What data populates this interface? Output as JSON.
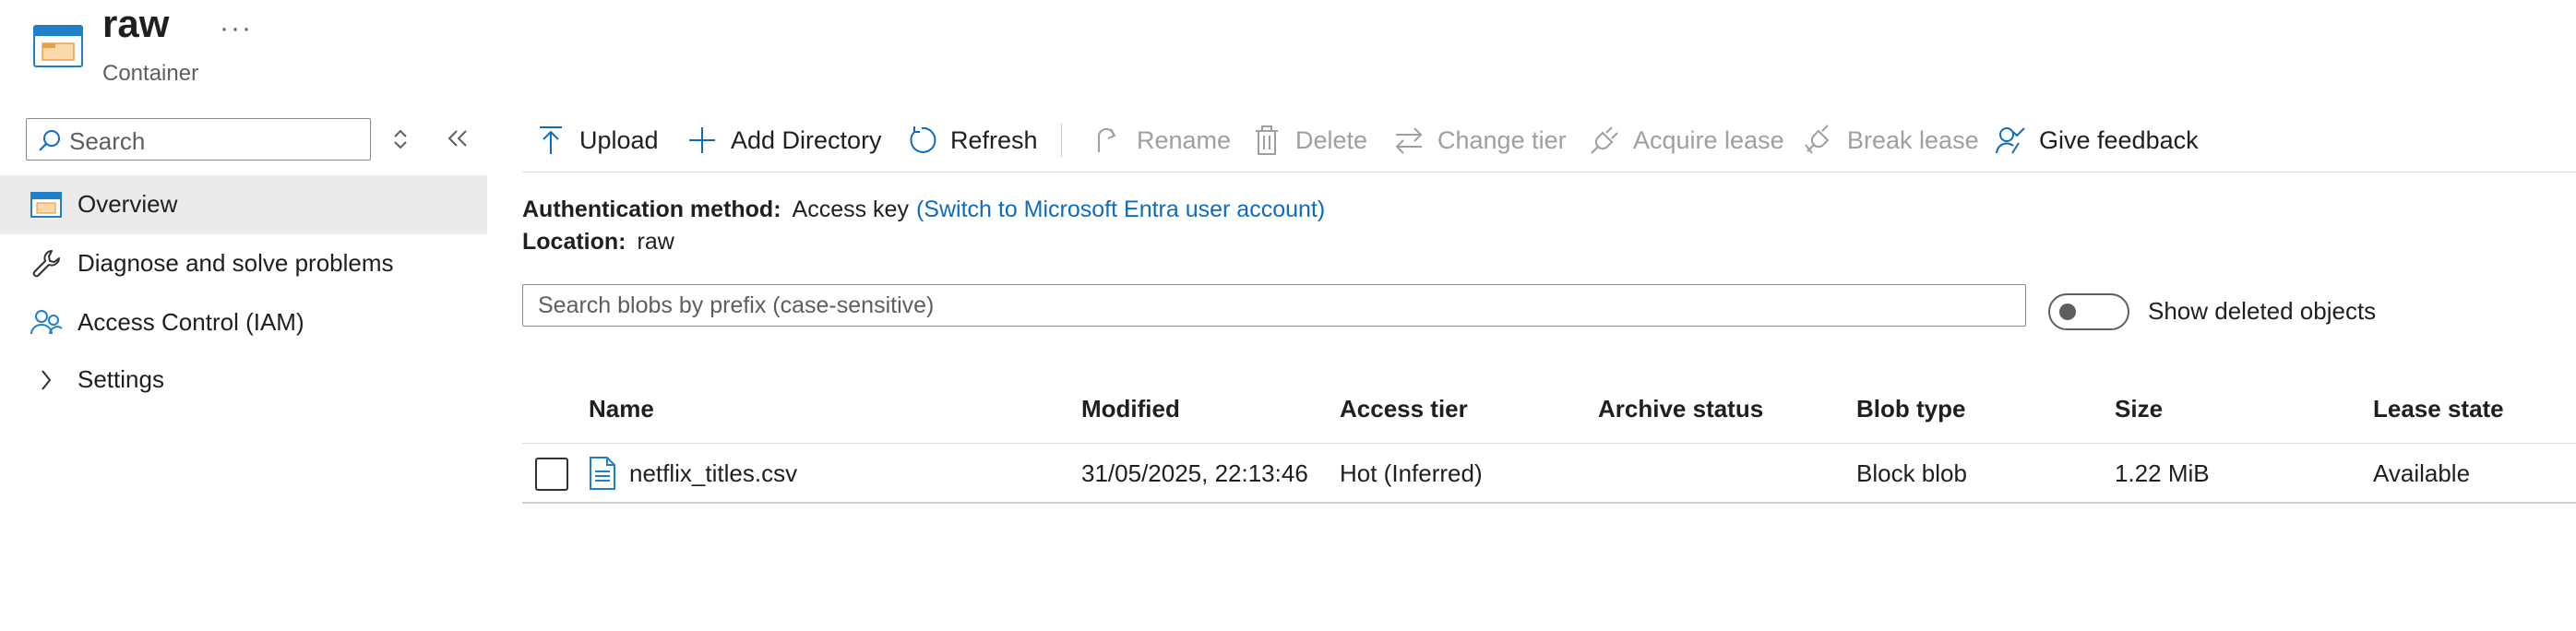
{
  "header": {
    "title": "raw",
    "more": "···",
    "subtitle": "Container",
    "icon": "container-icon"
  },
  "sidebar": {
    "search_placeholder": "Search",
    "items": [
      {
        "label": "Overview",
        "icon": "container-icon",
        "active": true
      },
      {
        "label": "Diagnose and solve problems",
        "icon": "wrench-icon"
      },
      {
        "label": "Access Control (IAM)",
        "icon": "people-icon"
      },
      {
        "label": "Settings",
        "icon": "chevron-right-icon"
      }
    ]
  },
  "toolbar": {
    "upload": "Upload",
    "add_directory": "Add Directory",
    "refresh": "Refresh",
    "rename": "Rename",
    "delete": "Delete",
    "change_tier": "Change tier",
    "acquire_lease": "Acquire lease",
    "break_lease": "Break lease",
    "give_feedback": "Give feedback"
  },
  "info": {
    "auth_label": "Authentication method:",
    "auth_value": "Access key",
    "auth_link": "(Switch to Microsoft Entra user account)",
    "location_label": "Location:",
    "location_value": "raw"
  },
  "blob_search_placeholder": "Search blobs by prefix (case-sensitive)",
  "show_deleted": {
    "label": "Show deleted objects",
    "on": false
  },
  "table": {
    "columns": [
      "Name",
      "Modified",
      "Access tier",
      "Archive status",
      "Blob type",
      "Size",
      "Lease state"
    ],
    "rows": [
      {
        "name": "netflix_titles.csv",
        "modified": "31/05/2025, 22:13:46",
        "access_tier": "Hot (Inferred)",
        "archive_status": "",
        "blob_type": "Block blob",
        "size": "1.22 MiB",
        "lease_state": "Available"
      }
    ]
  },
  "colors": {
    "accent": "#0f6cbd",
    "disabled": "#a19f9d",
    "active_nav_bg": "#edebe9"
  }
}
